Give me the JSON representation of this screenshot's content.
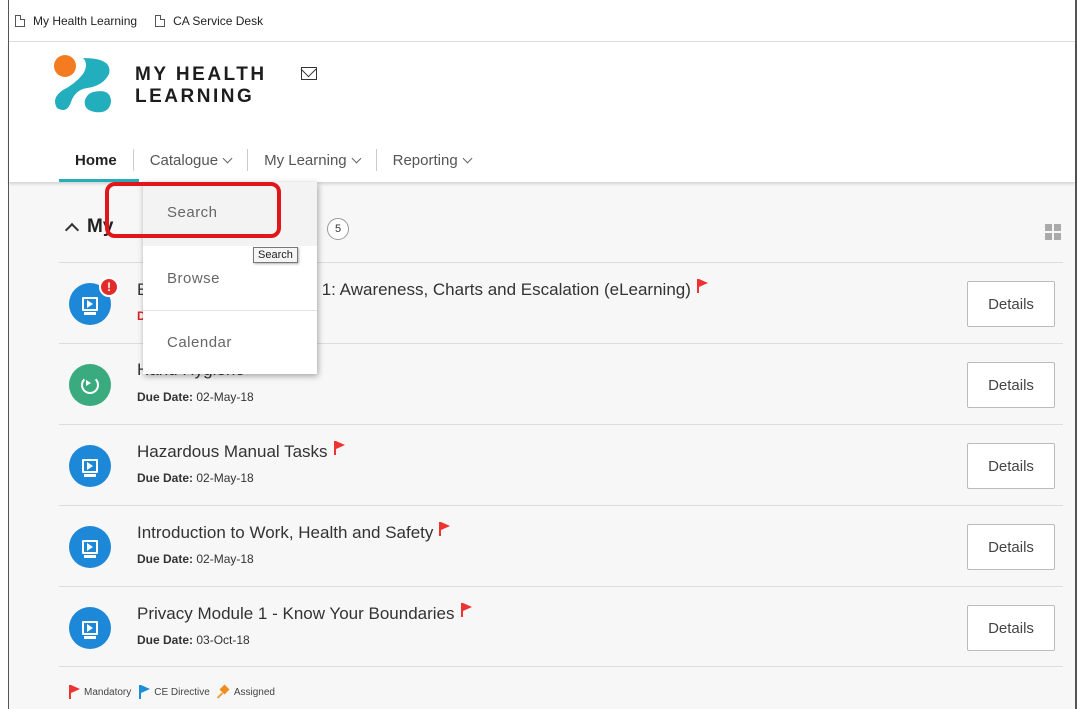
{
  "bookmarks": [
    {
      "label": "My Health Learning"
    },
    {
      "label": "CA Service Desk"
    }
  ],
  "brand": {
    "line1": "MY HEALTH",
    "line2": "LEARNING"
  },
  "nav": {
    "home": "Home",
    "catalogue": "Catalogue",
    "my_learning": "My Learning",
    "reporting": "Reporting"
  },
  "section": {
    "title": "My",
    "count": "5"
  },
  "dropdown": {
    "items": [
      "Search",
      "Browse",
      "Calendar"
    ],
    "tooltip": "Search"
  },
  "courses": [
    {
      "title": "E",
      "title_tail": "Tier 1: Awareness, Charts and Escalation (eLearning)",
      "due_label": "D",
      "due_date": "",
      "details": "Details",
      "icon": "video-icon",
      "alert": "!"
    },
    {
      "title": "Hand Hygiene",
      "due_label": "Due Date:",
      "due_date": "02-May-18",
      "details": "Details",
      "icon": "refresh-icon"
    },
    {
      "title": "Hazardous Manual Tasks",
      "due_label": "Due Date:",
      "due_date": "02-May-18",
      "details": "Details",
      "icon": "video-icon"
    },
    {
      "title": "Introduction to Work, Health and Safety",
      "due_label": "Due Date:",
      "due_date": "02-May-18",
      "details": "Details",
      "icon": "video-icon"
    },
    {
      "title": "Privacy Module 1 - Know Your Boundaries",
      "due_label": "Due Date:",
      "due_date": "03-Oct-18",
      "details": "Details",
      "icon": "video-icon"
    }
  ],
  "legend": {
    "mandatory": "Mandatory",
    "ce_directive": "CE Directive",
    "assigned": "Assigned"
  },
  "colors": {
    "accent": "#25aeb9",
    "flag": "#e33333",
    "highlight": "#e0161b",
    "course_icon": "#1e88d8",
    "course_icon_alt": "#3aab7e"
  }
}
